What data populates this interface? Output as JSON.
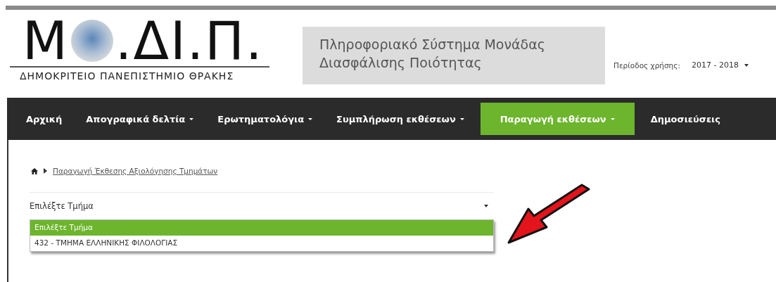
{
  "logo": {
    "letters_left": "Μ",
    "letters_right": ".ΔΙ.Π.",
    "subtitle": "ΔΗΜΟΚΡΙΤΕΙΟ ΠΑΝΕΠΙΣΤΗΜΙΟ ΘΡΑΚΗΣ"
  },
  "system_title": "Πληροφοριακό Σύστημα Μονάδας Διασφάλισης Ποιότητας",
  "period": {
    "label": "Περίοδος χρήσης:",
    "value": "2017 - 2018"
  },
  "nav": [
    {
      "label": "Αρχική",
      "has_menu": false,
      "selected": false
    },
    {
      "label": "Απογραφικά δελτία",
      "has_menu": true,
      "selected": false
    },
    {
      "label": "Ερωτηματολόγια",
      "has_menu": true,
      "selected": false
    },
    {
      "label": "Συμπλήρωση εκθέσεων",
      "has_menu": true,
      "selected": false
    },
    {
      "label": "Παραγωγή εκθέσεων",
      "has_menu": true,
      "selected": true
    },
    {
      "label": "Δημοσιεύσεις",
      "has_menu": false,
      "selected": false
    }
  ],
  "breadcrumb": {
    "link": "Παραγωγή Έκθεσης Αξιολόγησης Τμημάτων"
  },
  "select": {
    "value": "Επιλέξτε Τμήμα",
    "options": [
      {
        "label": "Επιλέξτε Τμήμα",
        "selected": true
      },
      {
        "label": "432 - ΤΜΗΜΑ ΕΛΛΗΝΙΚΗΣ ΦΙΛΟΛΟΓΙΑΣ",
        "selected": false
      }
    ]
  }
}
